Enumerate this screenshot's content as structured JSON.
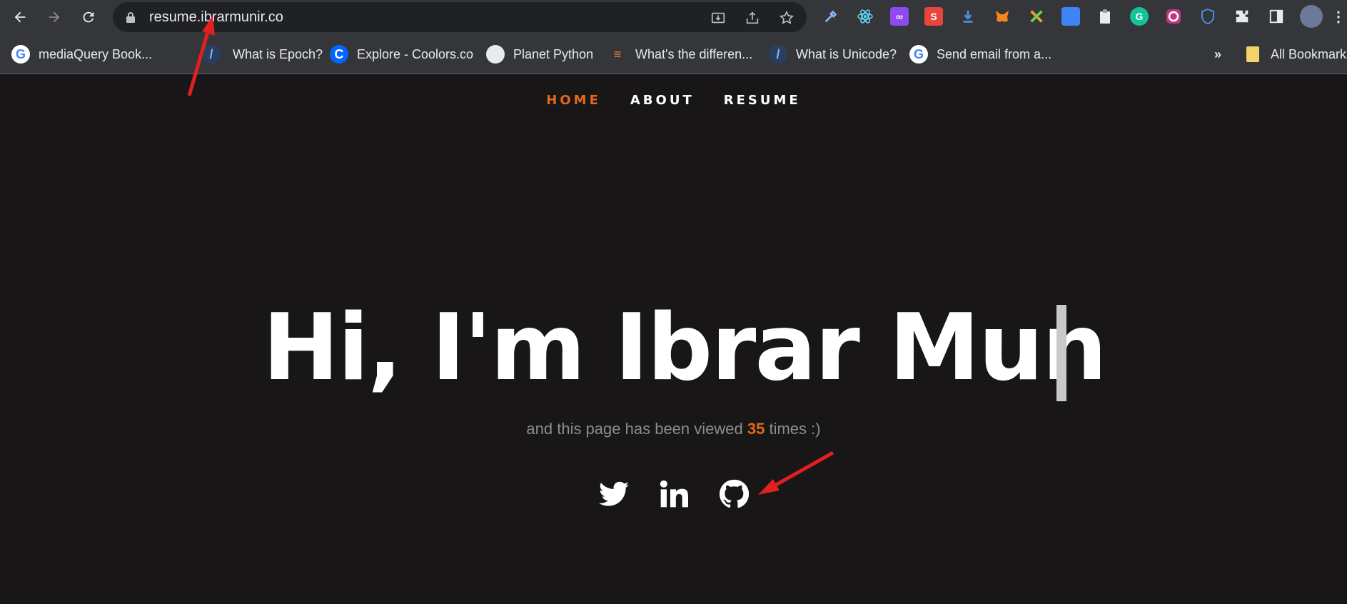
{
  "browser": {
    "url": "resume.ibrarmunir.co",
    "bookmarks": [
      {
        "label": "mediaQuery Book...",
        "icon": "google-icon"
      },
      {
        "label": "What is Epoch?",
        "icon": "slash-icon"
      },
      {
        "label": "Explore - Coolors.co",
        "icon": "coolors-icon"
      },
      {
        "label": "Planet Python",
        "icon": "globe-icon"
      },
      {
        "label": "What's the differen...",
        "icon": "stackoverflow-icon"
      },
      {
        "label": "What is Unicode?",
        "icon": "slash-icon"
      },
      {
        "label": "Send email from a...",
        "icon": "google-icon"
      }
    ],
    "overflow": "»",
    "all_bookmarks": "All Bookmarks"
  },
  "nav": {
    "home": "HOME",
    "about": "ABOUT",
    "resume": "RESUME"
  },
  "hero": {
    "title": "Hi, I'm Ibrar Mun"
  },
  "views": {
    "prefix": "and this page has been viewed ",
    "count": "35",
    "suffix": " times :)"
  },
  "social": [
    "twitter-icon",
    "linkedin-icon",
    "github-icon"
  ],
  "colors": {
    "accent": "#e2691b",
    "background": "#181617",
    "annotation_arrow": "#e02020"
  }
}
